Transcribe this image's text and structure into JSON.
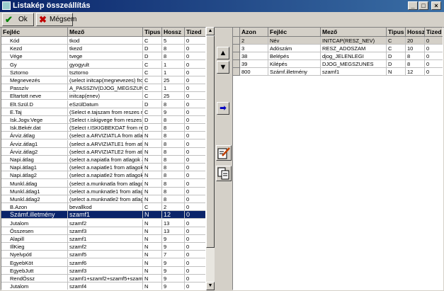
{
  "window": {
    "title": "Listakép összeállítás",
    "minimize": "_",
    "maximize": "□",
    "close": "×"
  },
  "toolbar": {
    "ok_label": "Ok",
    "cancel_label": "Mégsem"
  },
  "left_grid": {
    "columns": [
      "Fejléc",
      "Mező",
      "Tipus",
      "Hossz",
      "Tized"
    ],
    "rows": [
      [
        "Kód",
        "tkod",
        "C",
        "5",
        "0"
      ],
      [
        "Kezd",
        "tkezd",
        "D",
        "8",
        "0"
      ],
      [
        "Vége",
        "tvege",
        "D",
        "8",
        "0"
      ],
      [
        "Gy",
        "gyogyult",
        "C",
        "1",
        "0"
      ],
      [
        "Sztorno",
        "tsztorno",
        "C",
        "1",
        "0"
      ],
      [
        "Megnevezés",
        "(select initcap(megnevezes) from tkod",
        "C",
        "25",
        "0"
      ],
      [
        "Passzív",
        "A_PASSZIV(DJOG_MEGSZUNES",
        "C",
        "1",
        "0"
      ],
      [
        "Eltartott neve",
        "initcap(enev)",
        "C",
        "25",
        "0"
      ],
      [
        "Elt.Szül.D",
        "eSzülDatum",
        "D",
        "8",
        "0"
      ],
      [
        "E.Taj",
        "(Select e.tajszam from reszes r where",
        "C",
        "9",
        "0"
      ],
      [
        "Isk.Jogv.Vege",
        "(Select r.iskigvege from reszes r where",
        "D",
        "8",
        "0"
      ],
      [
        "Isk.Bekér.dat",
        "(Select r.ISKIGBEKDAT from reszes",
        "D",
        "8",
        "0"
      ],
      [
        "Árviz.átlag",
        "(select a.ARVIZIATLA from atlagok a",
        "N",
        "8",
        "0"
      ],
      [
        "Árviz.átlag1",
        "(select a.ARVIZIATLE1 from atlagok",
        "N",
        "8",
        "0"
      ],
      [
        "Árviz.átlag2",
        "(select a.ARVIZIATLE2 from atlagok",
        "N",
        "8",
        "0"
      ],
      [
        "Napi.átlag",
        "(select a.napiatla from atlagok a where",
        "N",
        "8",
        "0"
      ],
      [
        "Napi.átlag1",
        "(select a.napiatle1 from atlagok a where",
        "N",
        "8",
        "0"
      ],
      [
        "Napi.átlag2",
        "(select a.napiatle2 from atlagok a where",
        "N",
        "8",
        "0"
      ],
      [
        "Munkl.átlag",
        "(select a.munknatla from atlagok a wh",
        "N",
        "8",
        "0"
      ],
      [
        "Munkl.átlag1",
        "(select a.munknatle1 from atlagok a wh",
        "N",
        "8",
        "0"
      ],
      [
        "Munkl.átlag2",
        "(select a.munknatle2 from atlagok a wh",
        "N",
        "8",
        "0"
      ],
      [
        "B.Azon",
        "bevallkod",
        "C",
        "2",
        "0"
      ],
      [
        "Számf.illetmény",
        "szamf1",
        "N",
        "12",
        "0"
      ],
      [
        "Jutalom",
        "szamf2",
        "N",
        "13",
        "0"
      ],
      [
        "Összesen",
        "szamf3",
        "N",
        "13",
        "0"
      ],
      [
        "Alapill",
        "szamf1",
        "N",
        "9",
        "0"
      ],
      [
        "IllKieg",
        "szamf2",
        "N",
        "9",
        "0"
      ],
      [
        "Nyelvpótl",
        "szamf5",
        "N",
        "7",
        "0"
      ],
      [
        "EgyebKöt",
        "szamf6",
        "N",
        "9",
        "0"
      ],
      [
        "EgyebJutt",
        "szamf3",
        "N",
        "9",
        "0"
      ],
      [
        "RendÖssz",
        "szamf1+szamf2+szamf5+szamf6+sza",
        "N",
        "9",
        "0"
      ],
      [
        "Jutalom",
        "szamf4",
        "N",
        "9",
        "0"
      ]
    ]
  },
  "middle_buttons": {
    "up": "▲",
    "down": "▼",
    "move_right": "➡"
  },
  "right_grid": {
    "columns": [
      "Azon",
      "Fejléc",
      "Mező",
      "Tipus",
      "Hossz",
      "Tized"
    ],
    "rows": [
      [
        "2",
        "Név",
        "INITCAP(RESZ_NEV)",
        "C",
        "20",
        "0"
      ],
      [
        "3",
        "Adószám",
        "RESZ_ADOSZAM",
        "C",
        "10",
        "0"
      ],
      [
        "38",
        "Belépés",
        "djog_JELENLEGI",
        "D",
        "8",
        "0"
      ],
      [
        "39",
        "Kilépés",
        "DJOG_MEGSZUNES",
        "D",
        "8",
        "0"
      ],
      [
        "800",
        "Számf.illetmény",
        "szamf1",
        "N",
        "12",
        "0"
      ]
    ]
  },
  "colors": {
    "selection": "#0a246a",
    "titlebar": "#0a246a",
    "face": "#d4d0c8"
  }
}
